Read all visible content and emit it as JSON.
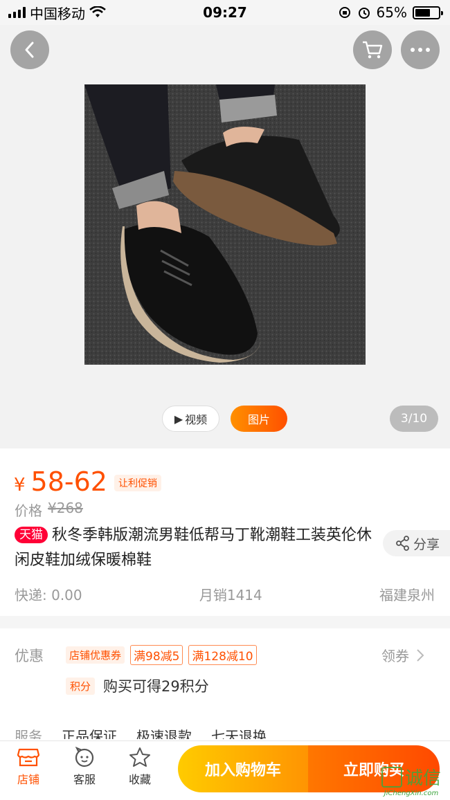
{
  "status_bar": {
    "carrier": "中国移动",
    "time": "09:27",
    "battery": "65%",
    "battery_level": 0.65
  },
  "gallery": {
    "video_tab": "视频",
    "photo_tab": "图片",
    "counter": "3/10"
  },
  "product": {
    "currency": "¥",
    "price": "58-62",
    "promo_tag": "让利促销",
    "orig_label": "价格",
    "orig_price": "¥268",
    "badge": "天猫",
    "title": "秋冬季韩版潮流男鞋低帮马丁靴潮鞋工装英伦休闲皮鞋加绒保暖棉鞋",
    "share": "分享",
    "shipping": "快递: 0.00",
    "monthly_sales": "月销1414",
    "location": "福建泉州"
  },
  "promotions": {
    "label": "优惠",
    "store_coupon": "店铺优惠券",
    "coupon1": "满98减5",
    "coupon2": "满128减10",
    "get_coupon": "领券",
    "points_tag": "积分",
    "points_text": "购买可得29积分",
    "service_label": "服务",
    "service1": "正品保证",
    "service2": "极速退款",
    "service3": "七天退换"
  },
  "bottom_bar": {
    "store": "店铺",
    "service": "客服",
    "favorite": "收藏",
    "add_to_cart": "加入购物车",
    "buy_now": "立即购买"
  },
  "watermark": {
    "brand": "诚信",
    "url": "JiChengXin.com"
  },
  "colors": {
    "accent": "#ff5000",
    "tmall_red": "#ff0036",
    "cart_gradient_start": "#ffcb00",
    "buy_gradient_end": "#ff4900"
  }
}
